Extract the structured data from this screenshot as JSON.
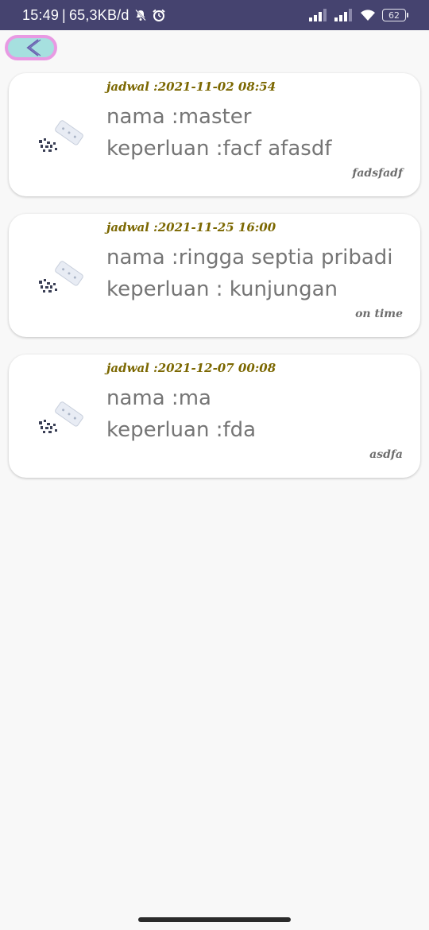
{
  "status_bar": {
    "time": "15:49",
    "separator": "|",
    "network_speed": "65,3KB/d",
    "battery_level": "62",
    "background_color": "#45436f"
  },
  "navigation": {
    "back_button_color": "#a6e0df",
    "back_button_border": "#e89ae3"
  },
  "schedule_list": [
    {
      "schedule": "jadwal :2021-11-02 08:54",
      "name": "nama :master",
      "purpose": "keperluan :facf afasdf",
      "status": "fadsfadf"
    },
    {
      "schedule": "jadwal :2021-11-25 16:00",
      "name": "nama :ringga septia pribadi",
      "purpose": "keperluan : kunjungan",
      "status": "on time"
    },
    {
      "schedule": "jadwal :2021-12-07 00:08",
      "name": "nama :ma",
      "purpose": "keperluan :fda",
      "status": "asdfa"
    }
  ]
}
